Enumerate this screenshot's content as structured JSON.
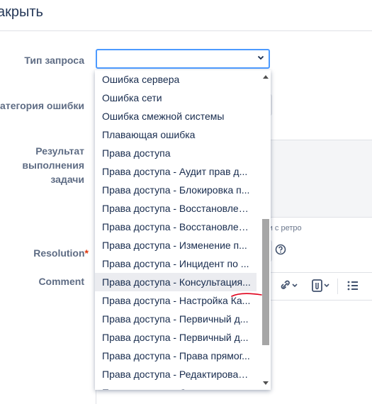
{
  "dialog": {
    "title": "акрыть"
  },
  "labels": {
    "request_type": "Тип запроса",
    "error_category": "Категория ошибки",
    "result_line1": "Результат",
    "result_line2": "выполнения",
    "result_line3": "задачи",
    "resolution": "Resolution",
    "resolution_required": "*",
    "comment": "Comment"
  },
  "request_type_select": {
    "value": ""
  },
  "hint_text": "чи с ретро",
  "dropdown": {
    "options": [
      "Ошибка сервера",
      "Ошибка сети",
      "Ошибка смежной системы",
      "Плавающая ошибка",
      "Права доступа",
      "Права доступа - Аудит прав д...",
      "Права доступа - Блокировка п...",
      "Права доступа - Восстановлен...",
      "Права доступа - Восстановлен...",
      "Права доступа - Изменение п...",
      "Права доступа - Инцидент по ...",
      "Права доступа - Консультация...",
      "Права доступа - Настройка Ка...",
      "Права доступа - Первичный д...",
      "Права доступа - Первичный д...",
      "Права доступа - Права прямог...",
      "Права доступа - Редактирован...",
      "Права доступа - С..."
    ],
    "highlighted": "Права доступа - Консультация...",
    "scroll_position": 0.52
  },
  "colors": {
    "focus": "#4c9aff",
    "required": "#de350b",
    "annotation": "#e0001b"
  },
  "icons": [
    "chevron-down-icon",
    "help-icon",
    "link-icon",
    "attachment-icon",
    "bullet-list-icon"
  ]
}
